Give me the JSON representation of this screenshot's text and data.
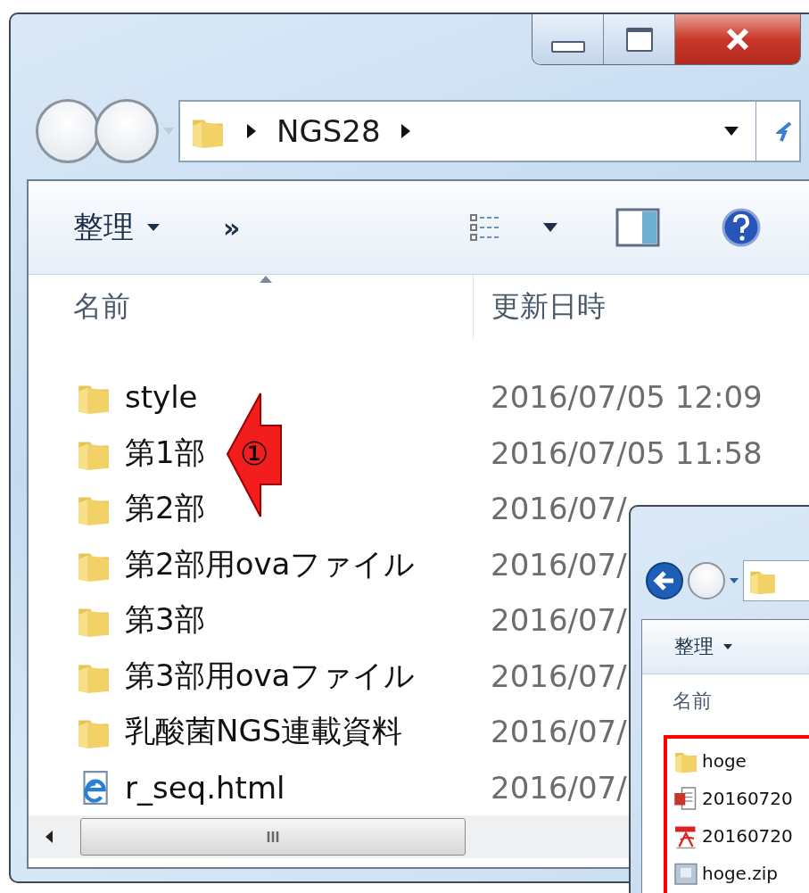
{
  "window": {
    "address": {
      "path": [
        "NGS28"
      ]
    },
    "toolbar": {
      "organize": "整理",
      "more": "»"
    },
    "columns": [
      {
        "label": "名前",
        "sorted": true
      },
      {
        "label": "更新日時",
        "sorted": false
      }
    ],
    "rows": [
      {
        "kind": "folder",
        "name": "style",
        "modified": "2016/07/05 12:09"
      },
      {
        "kind": "folder",
        "name": "第1部",
        "modified": "2016/07/05 11:58"
      },
      {
        "kind": "folder",
        "name": "第2部",
        "modified": "2016/07/"
      },
      {
        "kind": "folder",
        "name": "第2部用ovaファイル",
        "modified": "2016/07/"
      },
      {
        "kind": "folder",
        "name": "第3部",
        "modified": "2016/07/"
      },
      {
        "kind": "folder",
        "name": "第3部用ovaファイル",
        "modified": "2016/07/"
      },
      {
        "kind": "folder",
        "name": "乳酸菌NGS連載資料",
        "modified": "2016/07/"
      },
      {
        "kind": "html",
        "name": "r_seq.html",
        "modified": "2016/07/"
      }
    ]
  },
  "callout": {
    "label": "①"
  },
  "second_window": {
    "toolbar": {
      "organize": "整理"
    },
    "columns": [
      {
        "label": "名前"
      }
    ],
    "files": [
      {
        "kind": "folder",
        "name": "hoge"
      },
      {
        "kind": "powerpoint",
        "name": "20160720"
      },
      {
        "kind": "pdf",
        "name": "20160720"
      },
      {
        "kind": "zip",
        "name": "hoge.zip"
      }
    ]
  }
}
